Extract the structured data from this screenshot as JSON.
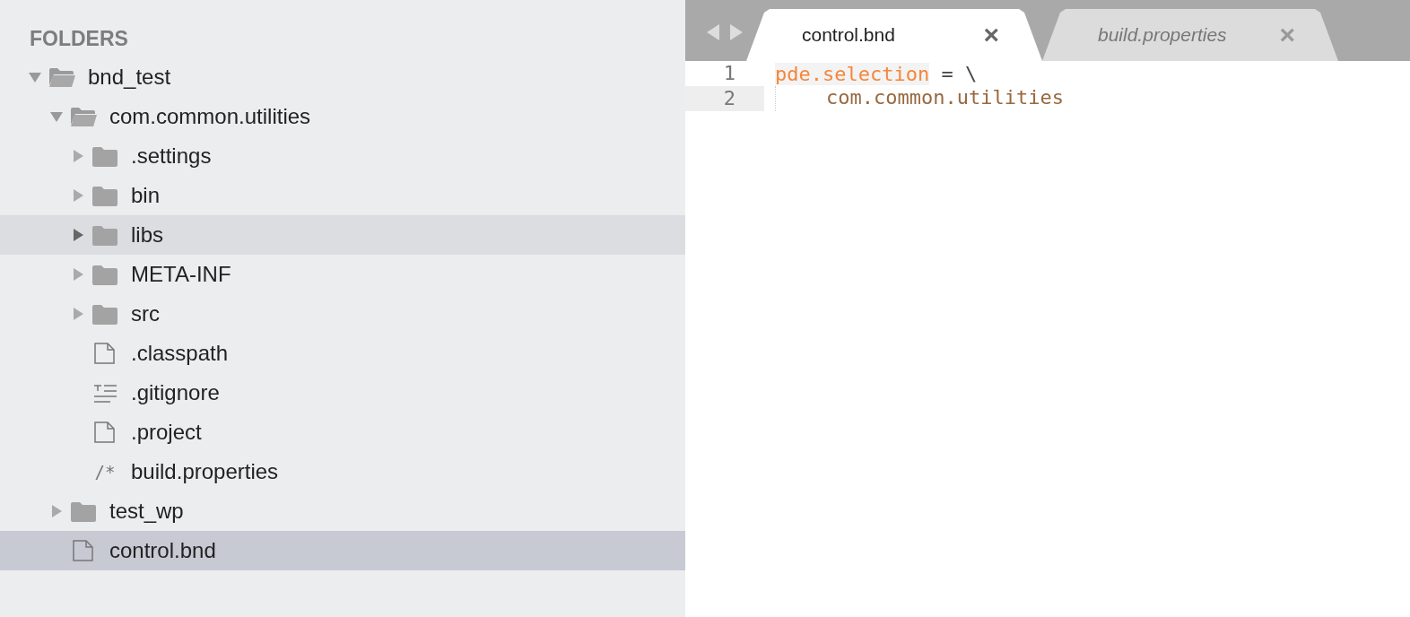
{
  "sidebar": {
    "header": "FOLDERS",
    "tree": [
      {
        "label": "bnd_test",
        "kind": "folder",
        "expanded": true,
        "highlighted": false,
        "selected": false,
        "children": [
          {
            "label": "com.common.utilities",
            "kind": "folder",
            "expanded": true,
            "highlighted": false,
            "selected": false,
            "children": [
              {
                "label": ".settings",
                "kind": "folder",
                "expanded": false,
                "highlighted": false,
                "selected": false
              },
              {
                "label": "bin",
                "kind": "folder",
                "expanded": false,
                "highlighted": false,
                "selected": false
              },
              {
                "label": "libs",
                "kind": "folder",
                "expanded": false,
                "highlighted": true,
                "selected": false
              },
              {
                "label": "META-INF",
                "kind": "folder",
                "expanded": false,
                "highlighted": false,
                "selected": false
              },
              {
                "label": "src",
                "kind": "folder",
                "expanded": false,
                "highlighted": false,
                "selected": false
              },
              {
                "label": ".classpath",
                "kind": "file",
                "highlighted": false,
                "selected": false
              },
              {
                "label": ".gitignore",
                "kind": "text",
                "highlighted": false,
                "selected": false
              },
              {
                "label": ".project",
                "kind": "file",
                "highlighted": false,
                "selected": false
              },
              {
                "label": "build.properties",
                "kind": "comment",
                "icon_text": "/*",
                "highlighted": false,
                "selected": false
              }
            ]
          },
          {
            "label": "test_wp",
            "kind": "folder",
            "expanded": false,
            "highlighted": false,
            "selected": false
          },
          {
            "label": "control.bnd",
            "kind": "file",
            "highlighted": false,
            "selected": true
          }
        ]
      }
    ]
  },
  "tabs": [
    {
      "label": "control.bnd",
      "selected": true,
      "close": "×"
    },
    {
      "label": "build.properties",
      "selected": false,
      "close": "×"
    }
  ],
  "editor": {
    "lines": [
      {
        "number": "1",
        "current": false,
        "tokens": [
          {
            "text": "pde.selection",
            "kind": "key"
          },
          {
            "text": " = \\",
            "kind": "plain"
          }
        ]
      },
      {
        "number": "2",
        "current": true,
        "indented": true,
        "tokens": [
          {
            "text": "com.common.utilities",
            "kind": "value"
          }
        ]
      }
    ]
  }
}
